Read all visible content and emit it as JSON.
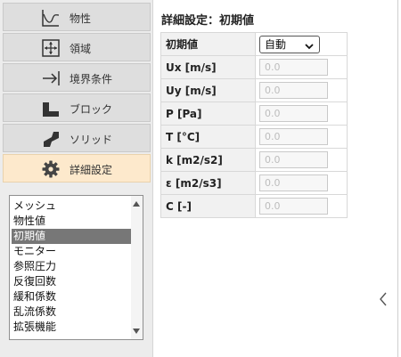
{
  "sidebar": {
    "nav": [
      {
        "label": "物性",
        "icon": "graph-icon",
        "active": false
      },
      {
        "label": "領域",
        "icon": "domain-icon",
        "active": false
      },
      {
        "label": "境界条件",
        "icon": "arrow-boundary-icon",
        "active": false
      },
      {
        "label": "ブロック",
        "icon": "block-icon",
        "active": false
      },
      {
        "label": "ソリッド",
        "icon": "solid-icon",
        "active": false
      },
      {
        "label": "詳細設定",
        "icon": "gear-icon",
        "active": true
      }
    ],
    "list_items": [
      "メッシュ",
      "物性値",
      "初期値",
      "モニター",
      "参照圧力",
      "反復回数",
      "緩和係数",
      "乱流係数",
      "拡張機能"
    ],
    "selected_item": "初期値"
  },
  "main": {
    "title": "詳細設定：初期値",
    "rows": [
      {
        "label": "初期値",
        "type": "select",
        "value": "自動"
      },
      {
        "label": "Ux [m/s]",
        "type": "input",
        "placeholder": "0.0"
      },
      {
        "label": "Uy [m/s]",
        "type": "input",
        "placeholder": "0.0"
      },
      {
        "label": "P [Pa]",
        "type": "input",
        "placeholder": "0.0"
      },
      {
        "label": "T [°C]",
        "type": "input",
        "placeholder": "0.0"
      },
      {
        "label": "k [m2/s2]",
        "type": "input",
        "placeholder": "0.0"
      },
      {
        "label": "ε [m2/s3]",
        "type": "input",
        "placeholder": "0.0"
      },
      {
        "label": "C [-]",
        "type": "input",
        "placeholder": "0.0"
      }
    ]
  },
  "colors": {
    "active_nav": "#fde9cc",
    "selected_list": "#777777"
  }
}
